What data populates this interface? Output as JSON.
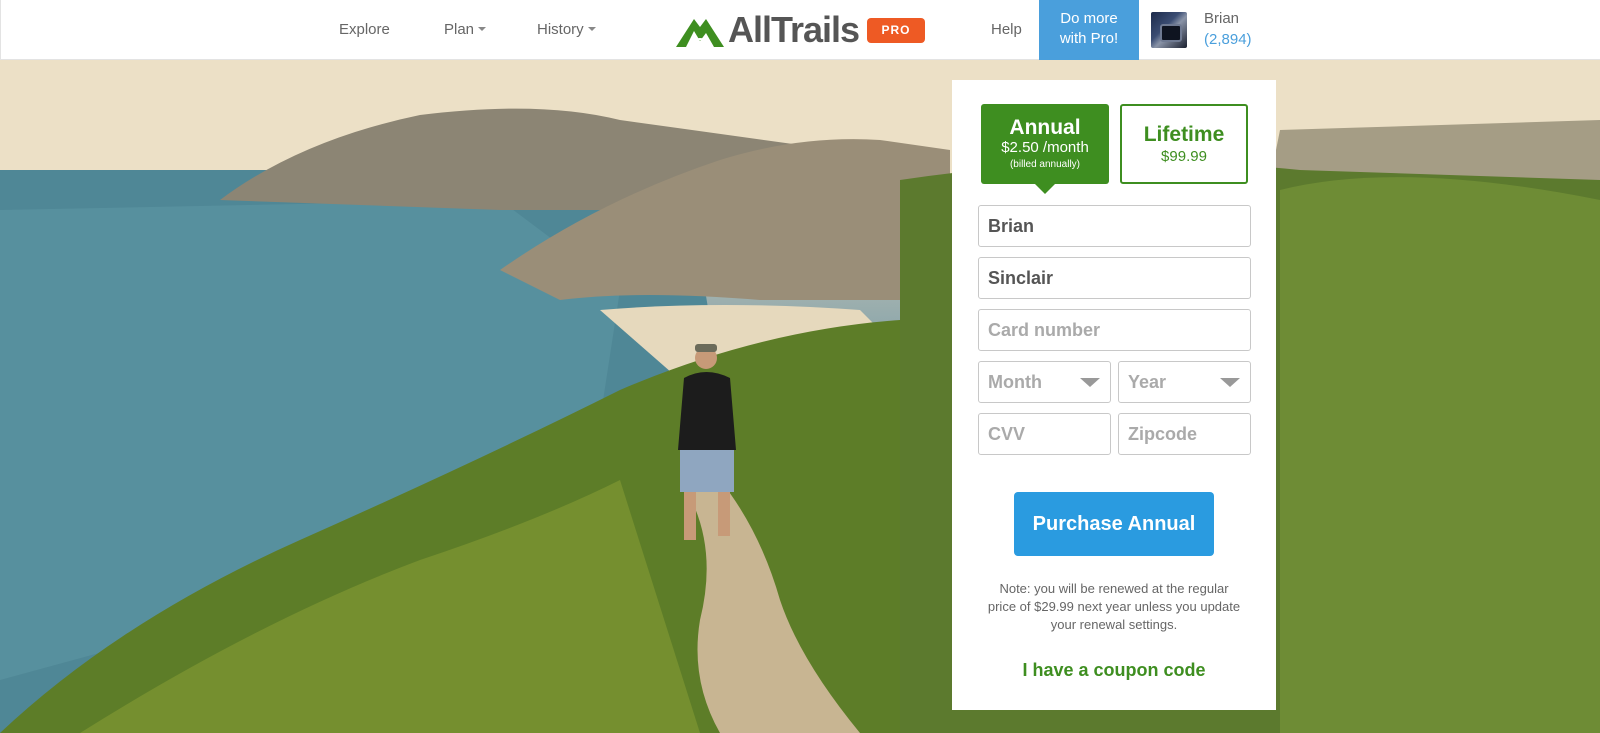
{
  "header": {
    "nav": {
      "explore": "Explore",
      "plan": "Plan",
      "history": "History"
    },
    "logo_text": "AllTrails",
    "pro_badge": "PRO",
    "help": "Help",
    "do_more": {
      "line1": "Do more",
      "line2": "with Pro!"
    },
    "user": {
      "name": "Brian",
      "count": "(2,894)"
    }
  },
  "plans": {
    "annual": {
      "title": "Annual",
      "price": "$2.50 /month",
      "note": "(billed annually)"
    },
    "lifetime": {
      "title": "Lifetime",
      "price": "$99.99"
    }
  },
  "form": {
    "first_name": "Brian",
    "last_name": "Sinclair",
    "card_number_placeholder": "Card number",
    "month": "Month",
    "year": "Year",
    "cvv_placeholder": "CVV",
    "zipcode_placeholder": "Zipcode"
  },
  "purchase_label": "Purchase Annual",
  "note": "Note: you will be renewed at the regular price of $29.99 next year unless you update your renewal settings.",
  "coupon_link": "I have a coupon code",
  "colors": {
    "brand_green": "#3e8e20",
    "pro_orange": "#ee5a24",
    "primary_blue": "#2a9be0",
    "header_blue": "#4a9fdc"
  }
}
